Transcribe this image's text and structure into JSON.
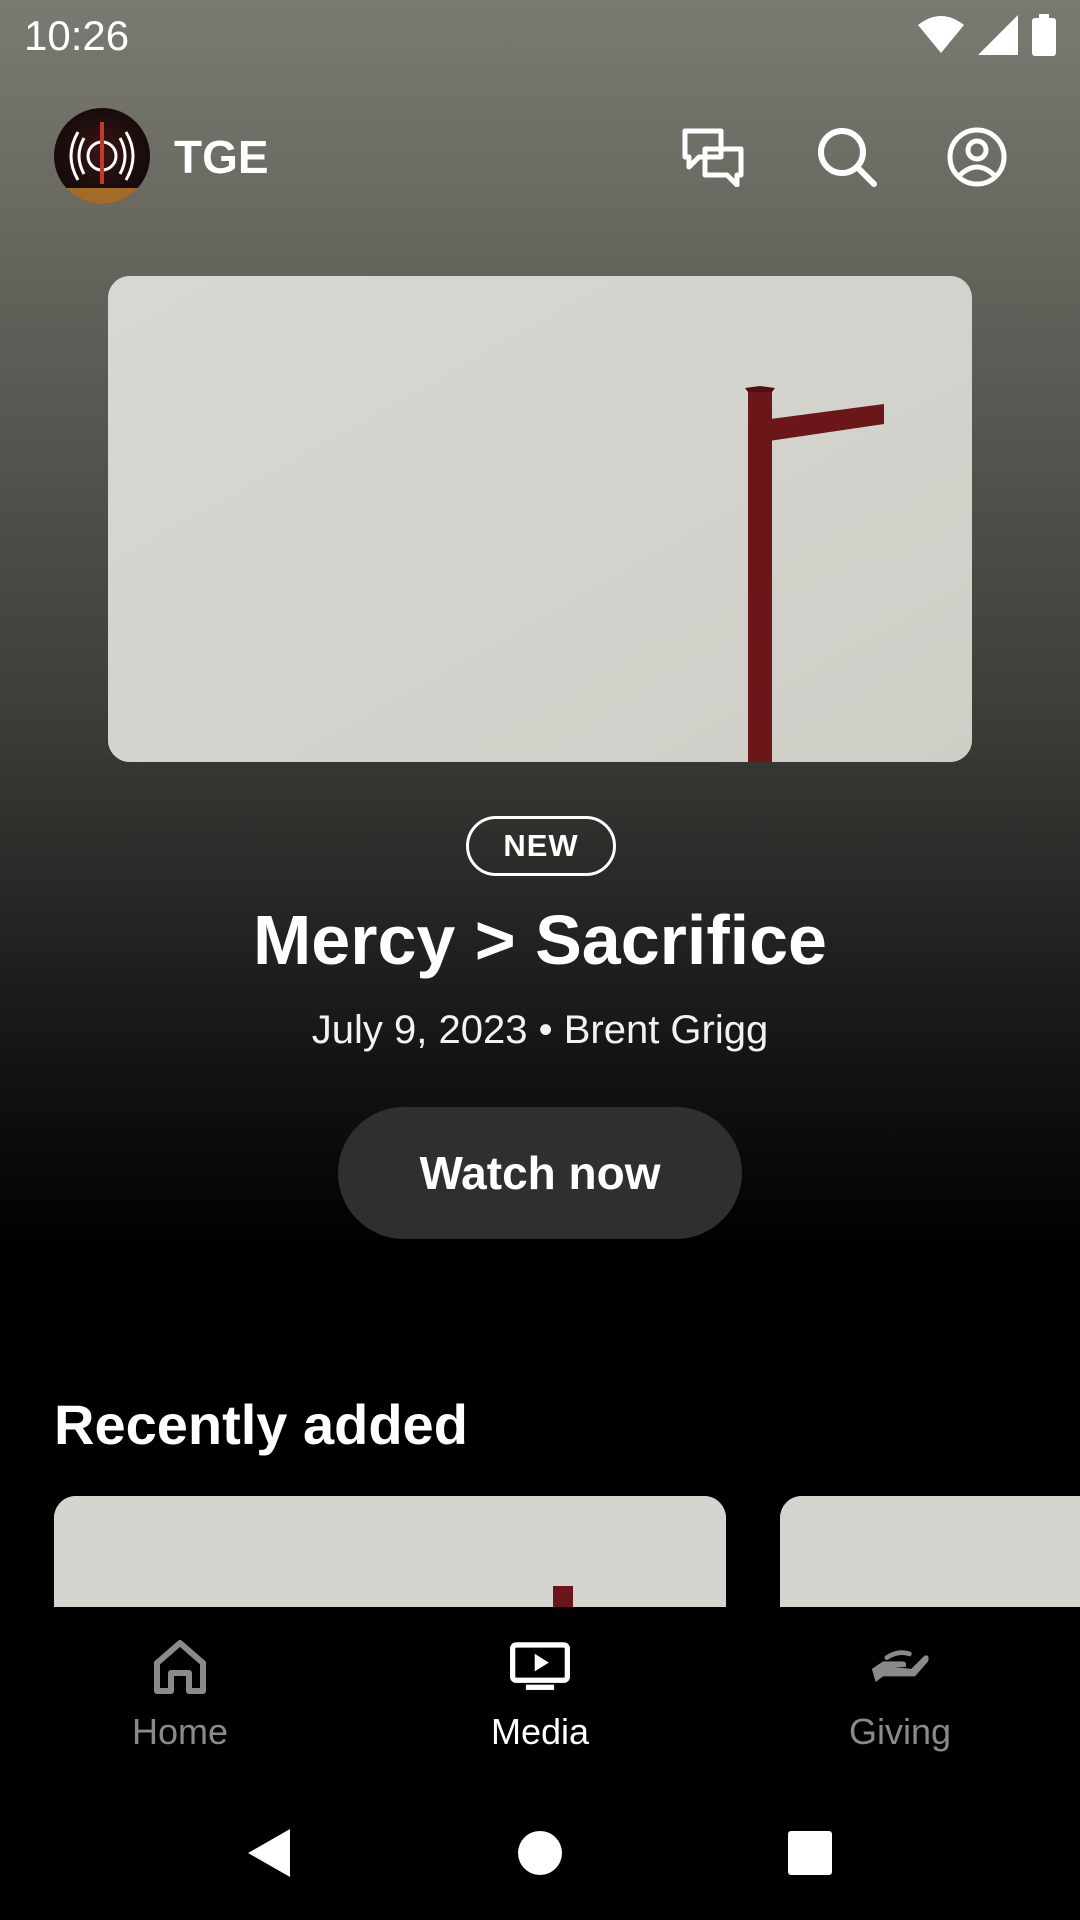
{
  "status_bar": {
    "time": "10:26"
  },
  "header": {
    "title": "TGE",
    "logo_text": "TGE"
  },
  "hero": {
    "badge": "NEW",
    "title": "Mercy > Sacrifice",
    "meta": "July 9, 2023 • Brent Grigg",
    "cta": "Watch now"
  },
  "recently_added": {
    "title": "Recently added"
  },
  "nav": {
    "items": [
      {
        "label": "Home",
        "icon": "home-icon",
        "active": false
      },
      {
        "label": "Media",
        "icon": "media-icon",
        "active": true
      },
      {
        "label": "Giving",
        "icon": "giving-icon",
        "active": false
      }
    ]
  },
  "colors": {
    "accent_cross": "#6b1618",
    "button_bg": "#2f2f2f",
    "inactive_nav": "#8a8a8a"
  }
}
